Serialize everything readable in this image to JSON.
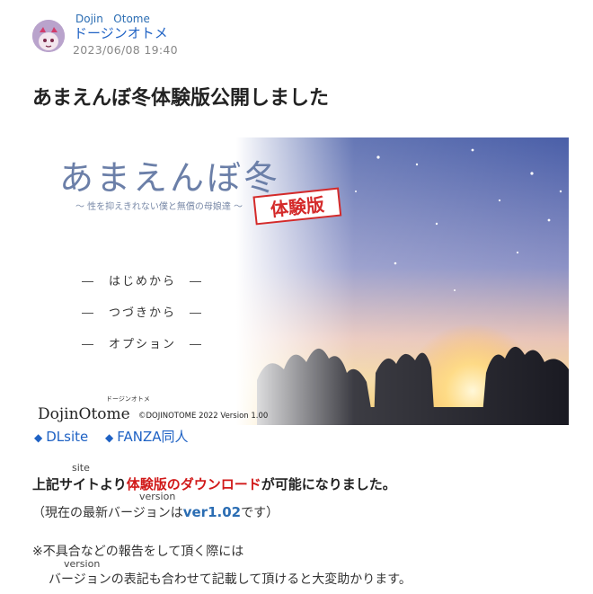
{
  "author": {
    "name_ruby": "Dojin   Otome",
    "name": "ドージンオトメ",
    "date": "2023/06/08 19:40"
  },
  "post": {
    "title": "あまえんぼ冬体験版公開しました"
  },
  "banner": {
    "game_title": "あまえんぼ冬",
    "subtitle": "〜 性を抑えきれない僕と無償の母娘達 〜",
    "stamp": "体験版",
    "menu": [
      "―　はじめから　―",
      "―　つづきから　―",
      "―　オプション　―"
    ],
    "logo": "DojinOtome",
    "logo_ruby": "ドージンオトメ",
    "copyright": "©DOJINOTOME 2022 Version 1.00"
  },
  "links": {
    "diamond": "◆",
    "dlsite": "DLsite",
    "fanza": "FANZA同人"
  },
  "body": {
    "ruby_site": "site",
    "line1_a": "上記サイトより",
    "line1_red": "体験版のダウンロード",
    "line1_b": "が可能になりました。",
    "ruby_version1": "version",
    "line2_a": "（現在の最新バージョンは",
    "line2_ver": "ver1.02",
    "line2_b": "です）",
    "line3": "※不具合などの報告をして頂く際には",
    "ruby_version2": "version",
    "line4": "バージョンの表記も合わせて記載して頂けると大変助かります。"
  },
  "colors": {
    "link": "#1f62c4",
    "highlight_red": "#d11a1a",
    "version_blue": "#2b6db3"
  }
}
